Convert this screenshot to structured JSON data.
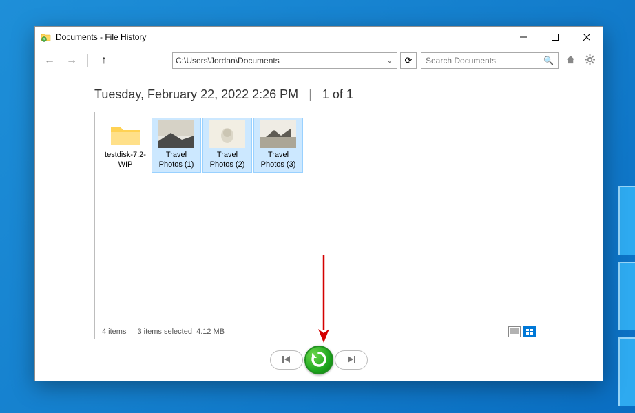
{
  "window": {
    "title": "Documents - File History"
  },
  "nav": {
    "address_path": "C:\\Users\\Jordan\\Documents",
    "search_placeholder": "Search Documents"
  },
  "version": {
    "timestamp": "Tuesday, February 22, 2022 2:26 PM",
    "page_indicator": "1 of 1"
  },
  "items": [
    {
      "name": "testdisk-7.2-WIP",
      "type": "folder",
      "selected": false
    },
    {
      "name": "Travel Photos (1)",
      "type": "image",
      "selected": true
    },
    {
      "name": "Travel Photos (2)",
      "type": "image",
      "selected": true
    },
    {
      "name": "Travel Photos (3)",
      "type": "image",
      "selected": true
    }
  ],
  "status": {
    "item_count": "4 items",
    "selection": "3 items selected",
    "size": "4.12 MB"
  }
}
